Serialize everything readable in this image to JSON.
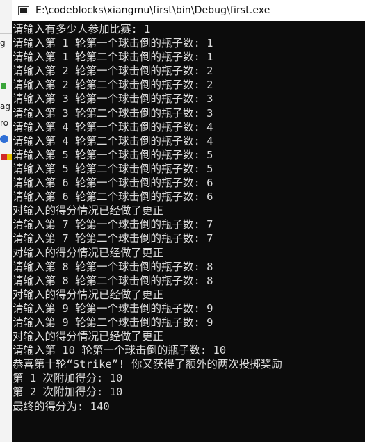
{
  "window": {
    "title": "E:\\codeblocks\\xiangmu\\first\\bin\\Debug\\first.exe"
  },
  "behind_fragments": [
    "g",
    "ag",
    "ro",
    "v"
  ],
  "console": {
    "lines": [
      "请输入有多少人参加比赛: 1",
      "请输入第 1 轮第一个球击倒的瓶子数: 1",
      "请输入第 1 轮第二个球击倒的瓶子数: 1",
      "请输入第 2 轮第一个球击倒的瓶子数: 2",
      "请输入第 2 轮第二个球击倒的瓶子数: 2",
      "请输入第 3 轮第一个球击倒的瓶子数: 3",
      "请输入第 3 轮第二个球击倒的瓶子数: 3",
      "请输入第 4 轮第一个球击倒的瓶子数: 4",
      "请输入第 4 轮第二个球击倒的瓶子数: 4",
      "请输入第 5 轮第一个球击倒的瓶子数: 5",
      "请输入第 5 轮第二个球击倒的瓶子数: 5",
      "请输入第 6 轮第一个球击倒的瓶子数: 6",
      "请输入第 6 轮第二个球击倒的瓶子数: 6",
      "对输入的得分情况已经做了更正",
      "请输入第 7 轮第一个球击倒的瓶子数: 7",
      "请输入第 7 轮第二个球击倒的瓶子数: 7",
      "对输入的得分情况已经做了更正",
      "请输入第 8 轮第一个球击倒的瓶子数: 8",
      "请输入第 8 轮第二个球击倒的瓶子数: 8",
      "对输入的得分情况已经做了更正",
      "请输入第 9 轮第一个球击倒的瓶子数: 9",
      "请输入第 9 轮第二个球击倒的瓶子数: 9",
      "对输入的得分情况已经做了更正",
      "请输入第 10 轮第一个球击倒的瓶子数: 10",
      "恭喜第十轮“Strike”! 你又获得了额外的两次投掷奖励",
      "第 1 次附加得分: 10",
      "第 2 次附加得分: 10",
      "最终的得分为: 140"
    ]
  },
  "colors": {
    "console_bg": "#0c0c0c",
    "console_text": "#dcdcdc",
    "titlebar_bg": "#ffffff"
  }
}
